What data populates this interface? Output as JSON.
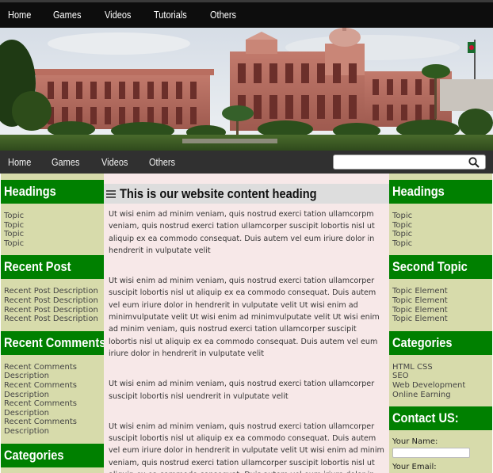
{
  "top_nav": [
    "Home",
    "Games",
    "Videos",
    "Tutorials",
    "Others"
  ],
  "sub_nav": [
    "Home",
    "Games",
    "Videos",
    "Others"
  ],
  "search": {
    "placeholder": ""
  },
  "left_sidebar": {
    "sections": [
      {
        "heading": "Headings",
        "items": [
          "Topic",
          "Topic",
          "Topic",
          "Topic"
        ]
      },
      {
        "heading": "Recent Post",
        "items": [
          "Recent Post Description",
          "Recent Post Description",
          "Recent Post Description",
          "Recent Post Description"
        ]
      },
      {
        "heading": "Recent Comments",
        "items": [
          "Recent Comments Description",
          "Recent Comments Description",
          "Recent Comments Description",
          "Recent Comments Description"
        ]
      },
      {
        "heading": "Categories",
        "items": []
      }
    ]
  },
  "main": {
    "title": "This is our website content heading",
    "paragraphs": [
      "Ut wisi enim ad minim veniam, quis nostrud exerci tation ullamcorpm veniam, quis nostrud exerci tation ullamcorper suscipit lobortis nisl ut aliquip ex ea commodo consequat. Duis autem vel eum iriure dolor in hendrerit in vulputate velit",
      "Ut wisi enim ad minim veniam, quis nostrud exerci tation ullamcorper suscipit lobortis nisl ut aliquip ex ea commodo consequat. Duis autem vel eum iriure dolor in hendrerit in vulputate velit Ut wisi enim ad minimvulputate velit Ut wisi enim ad minimvulputate velit Ut wisi enim ad minim veniam, quis nostrud exerci tation ullamcorper suscipit lobortis nisl ut aliquip ex ea commodo consequat. Duis autem vel eum iriure dolor in hendrerit in vulputate velit",
      "Ut wisi enim ad minim veniam, quis nostrud exerci tation ullamcorper suscipit lobortis nisl uendrerit in vulputate velit",
      "Ut wisi enim ad minim veniam, quis nostrud exerci tation ullamcorper suscipit lobortis nisl ut aliquip ex ea commodo consequat. Duis autem vel eum iriure dolor in hendrerit in vulputate velit Ut wisi enim ad minim veniam, quis nostrud exerci tation ullamcorper suscipit lobortis nisl ut aliquip ex ea commodo consequat. Duis autem vel eum iriure dolor in hendrerit in"
    ]
  },
  "right_sidebar": {
    "sections": [
      {
        "heading": "Headings",
        "items": [
          "Topic",
          "Topic",
          "Topic",
          "Topic"
        ]
      },
      {
        "heading": "Second Topic",
        "items": [
          "Topic Element",
          "Topic Element",
          "Topic Element",
          "Topic Element"
        ]
      },
      {
        "heading": "Categories",
        "items": [
          "HTML CSS",
          "SEO",
          "Web Development",
          "Online Earning"
        ]
      }
    ],
    "contact": {
      "heading": "Contact US:",
      "name_label": "Your Name:",
      "email_label": "Your Email:"
    }
  },
  "colors": {
    "sidebar_bg": "#d7dbab",
    "heading_green": "#008000",
    "main_bg": "#f7e8e8",
    "nav_bg": "#0d0d0d"
  }
}
